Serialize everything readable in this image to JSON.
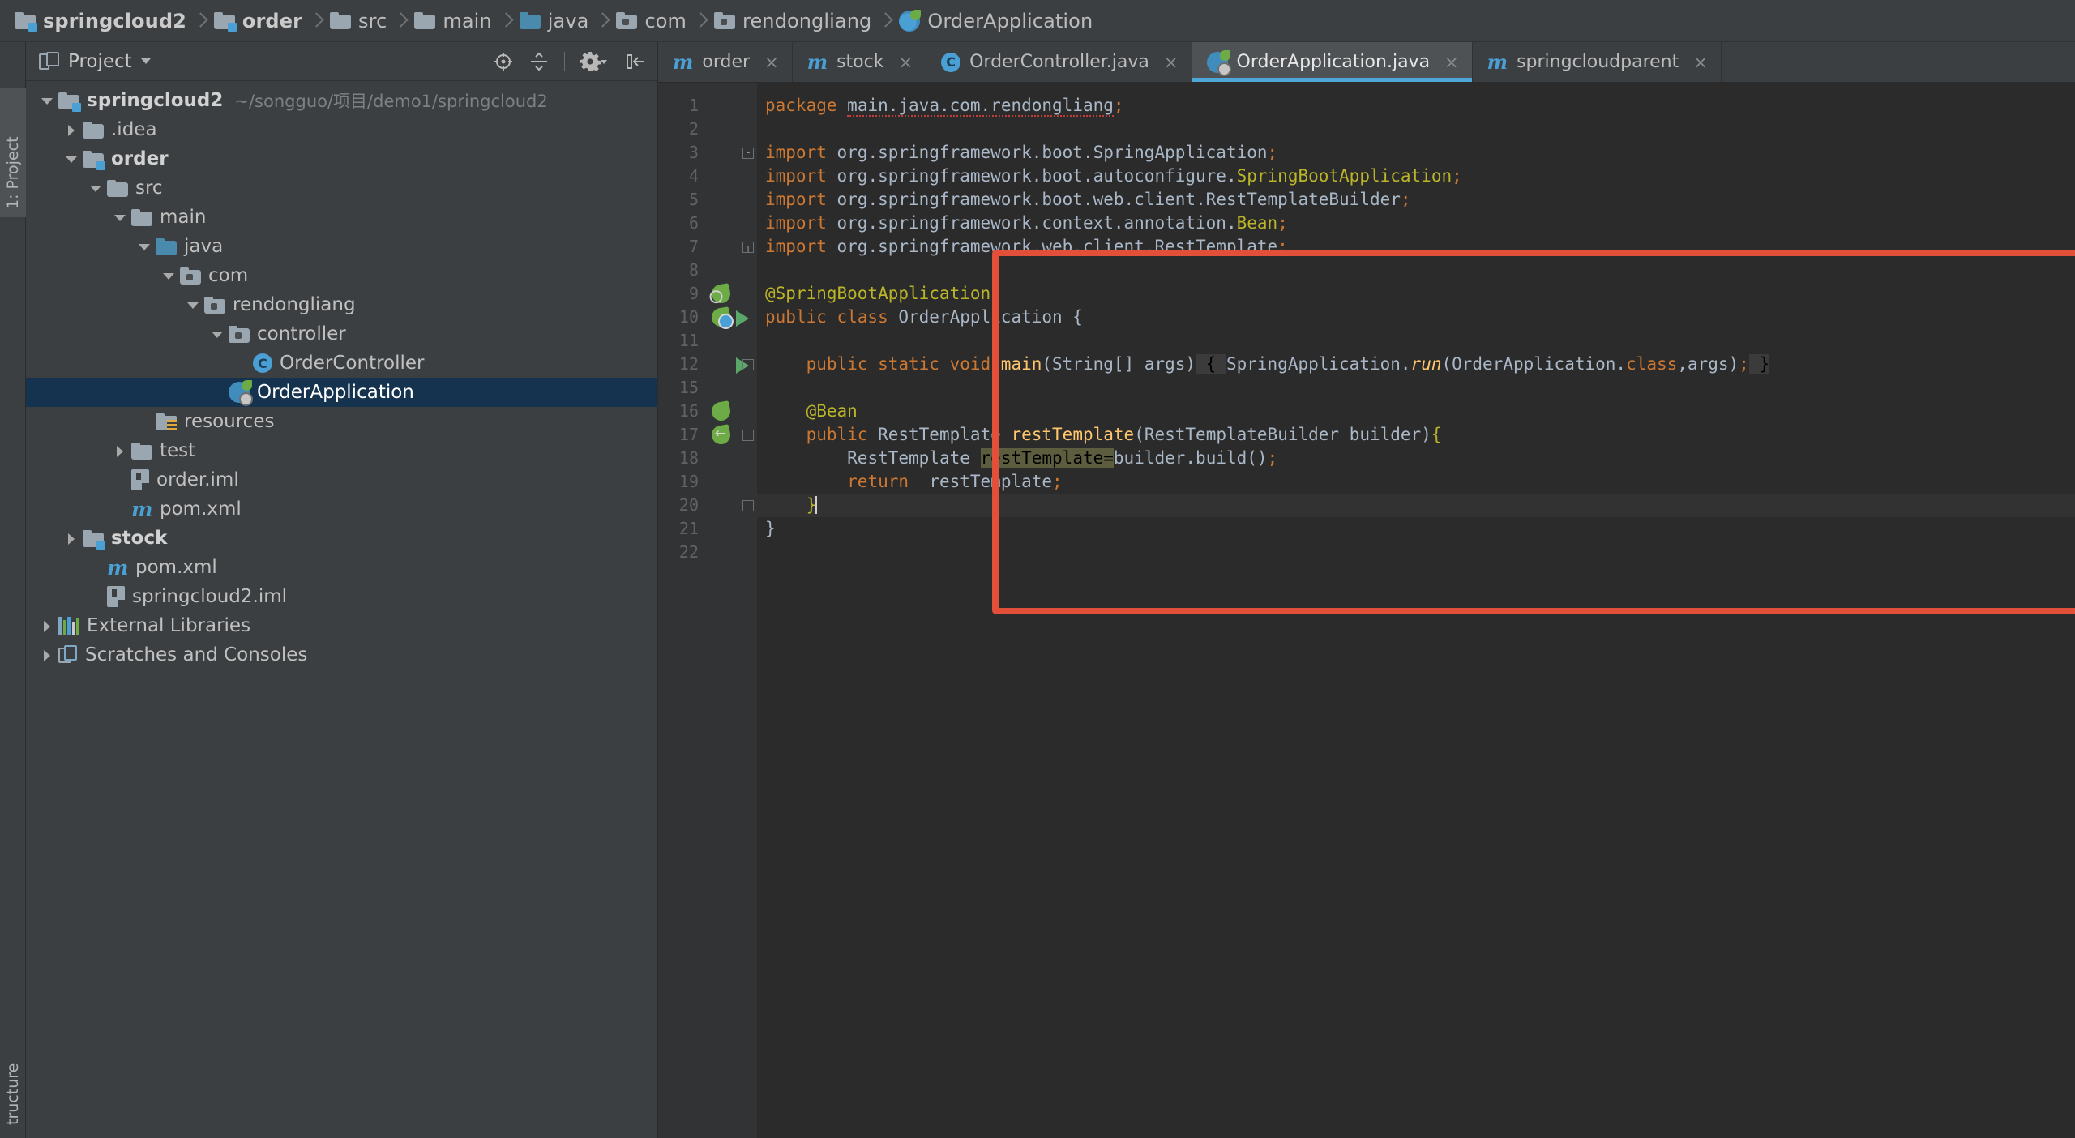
{
  "breadcrumb": [
    {
      "label": "springcloud2",
      "icon": "module-folder-icon",
      "bold": true
    },
    {
      "label": "order",
      "icon": "module-folder-icon",
      "bold": true
    },
    {
      "label": "src",
      "icon": "folder-icon",
      "bold": false
    },
    {
      "label": "main",
      "icon": "folder-icon",
      "bold": false
    },
    {
      "label": "java",
      "icon": "source-folder-icon",
      "bold": false
    },
    {
      "label": "com",
      "icon": "package-folder-icon",
      "bold": false
    },
    {
      "label": "rendongliang",
      "icon": "package-folder-icon",
      "bold": false
    },
    {
      "label": "OrderApplication",
      "icon": "spring-class-icon",
      "bold": false
    }
  ],
  "tool_strip": {
    "project_tab": "1: Project",
    "structure_tab": "tructure"
  },
  "project_panel": {
    "title": "Project",
    "tools": [
      {
        "name": "locate-icon",
        "label": "Select Opened File"
      },
      {
        "name": "collapse-all-icon",
        "label": "Collapse All"
      },
      {
        "name": "settings-gear-icon",
        "label": "Show Options Menu"
      },
      {
        "name": "hide-panel-icon",
        "label": "Hide"
      }
    ],
    "tree": [
      {
        "label": "springcloud2",
        "path": "~/songguo/项目/demo1/springcloud2",
        "indent": 0,
        "arrow": "open",
        "icon": "module-folder-icon",
        "bold": true,
        "selected": false
      },
      {
        "label": ".idea",
        "path": "",
        "indent": 1,
        "arrow": "closed",
        "icon": "folder-icon",
        "bold": false,
        "selected": false
      },
      {
        "label": "order",
        "path": "",
        "indent": 1,
        "arrow": "open",
        "icon": "module-folder-icon",
        "bold": true,
        "selected": false
      },
      {
        "label": "src",
        "path": "",
        "indent": 2,
        "arrow": "open",
        "icon": "folder-icon",
        "bold": false,
        "selected": false
      },
      {
        "label": "main",
        "path": "",
        "indent": 3,
        "arrow": "open",
        "icon": "folder-icon",
        "bold": false,
        "selected": false
      },
      {
        "label": "java",
        "path": "",
        "indent": 4,
        "arrow": "open",
        "icon": "source-folder-icon",
        "bold": false,
        "selected": false
      },
      {
        "label": "com",
        "path": "",
        "indent": 5,
        "arrow": "open",
        "icon": "package-folder-icon",
        "bold": false,
        "selected": false
      },
      {
        "label": "rendongliang",
        "path": "",
        "indent": 6,
        "arrow": "open",
        "icon": "package-folder-icon",
        "bold": false,
        "selected": false
      },
      {
        "label": "controller",
        "path": "",
        "indent": 7,
        "arrow": "open",
        "icon": "package-folder-icon",
        "bold": false,
        "selected": false
      },
      {
        "label": "OrderController",
        "path": "",
        "indent": 8,
        "arrow": "none",
        "icon": "java-class-icon",
        "bold": false,
        "selected": false
      },
      {
        "label": "OrderApplication",
        "path": "",
        "indent": 7,
        "arrow": "none",
        "icon": "spring-class-icon",
        "bold": false,
        "selected": true
      },
      {
        "label": "resources",
        "path": "",
        "indent": 4,
        "arrow": "none",
        "icon": "resources-folder-icon",
        "bold": false,
        "selected": false
      },
      {
        "label": "test",
        "path": "",
        "indent": 3,
        "arrow": "closed",
        "icon": "folder-icon",
        "bold": false,
        "selected": false
      },
      {
        "label": "order.iml",
        "path": "",
        "indent": 3,
        "arrow": "none",
        "icon": "iml-file-icon",
        "bold": false,
        "selected": false
      },
      {
        "label": "pom.xml",
        "path": "",
        "indent": 3,
        "arrow": "none",
        "icon": "maven-file-icon",
        "bold": false,
        "selected": false
      },
      {
        "label": "stock",
        "path": "",
        "indent": 1,
        "arrow": "closed",
        "icon": "module-folder-icon",
        "bold": true,
        "selected": false
      },
      {
        "label": "pom.xml",
        "path": "",
        "indent": 2,
        "arrow": "none",
        "icon": "maven-file-icon",
        "bold": false,
        "selected": false
      },
      {
        "label": "springcloud2.iml",
        "path": "",
        "indent": 2,
        "arrow": "none",
        "icon": "iml-file-icon",
        "bold": false,
        "selected": false
      },
      {
        "label": "External Libraries",
        "path": "",
        "indent": 0,
        "arrow": "closed",
        "icon": "libraries-icon",
        "bold": false,
        "selected": false
      },
      {
        "label": "Scratches and Consoles",
        "path": "",
        "indent": 0,
        "arrow": "closed",
        "icon": "scratches-icon",
        "bold": false,
        "selected": false
      }
    ]
  },
  "editor_tabs": [
    {
      "label": "order",
      "icon": "maven-file-icon",
      "active": false
    },
    {
      "label": "stock",
      "icon": "maven-file-icon",
      "active": false
    },
    {
      "label": "OrderController.java",
      "icon": "java-class-icon",
      "active": false
    },
    {
      "label": "OrderApplication.java",
      "icon": "spring-class-icon",
      "active": true
    },
    {
      "label": "springcloudparent",
      "icon": "maven-file-icon",
      "active": false
    }
  ],
  "code": {
    "line_numbers": [
      "1",
      "2",
      "3",
      "4",
      "5",
      "6",
      "7",
      "8",
      "9",
      "10",
      "11",
      "12",
      "15",
      "16",
      "17",
      "18",
      "19",
      "20",
      "21",
      "22"
    ],
    "lines": [
      "package main.java.com.rendongliang;",
      "",
      "import org.springframework.boot.SpringApplication;",
      "import org.springframework.boot.autoconfigure.SpringBootApplication;",
      "import org.springframework.boot.web.client.RestTemplateBuilder;",
      "import org.springframework.context.annotation.Bean;",
      "import org.springframework.web.client.RestTemplate;",
      "",
      "@SpringBootApplication",
      "public class OrderApplication {",
      "",
      "    public static void main(String[] args) { SpringApplication.run(OrderApplication.class,args); }",
      "",
      "    @Bean",
      "    public RestTemplate restTemplate(RestTemplateBuilder builder){",
      "        RestTemplate restTemplate=builder.build();",
      "        return  restTemplate;",
      "    }",
      "}",
      ""
    ]
  },
  "annotation": {
    "color": "#e2503a",
    "shape": "rectangle"
  }
}
